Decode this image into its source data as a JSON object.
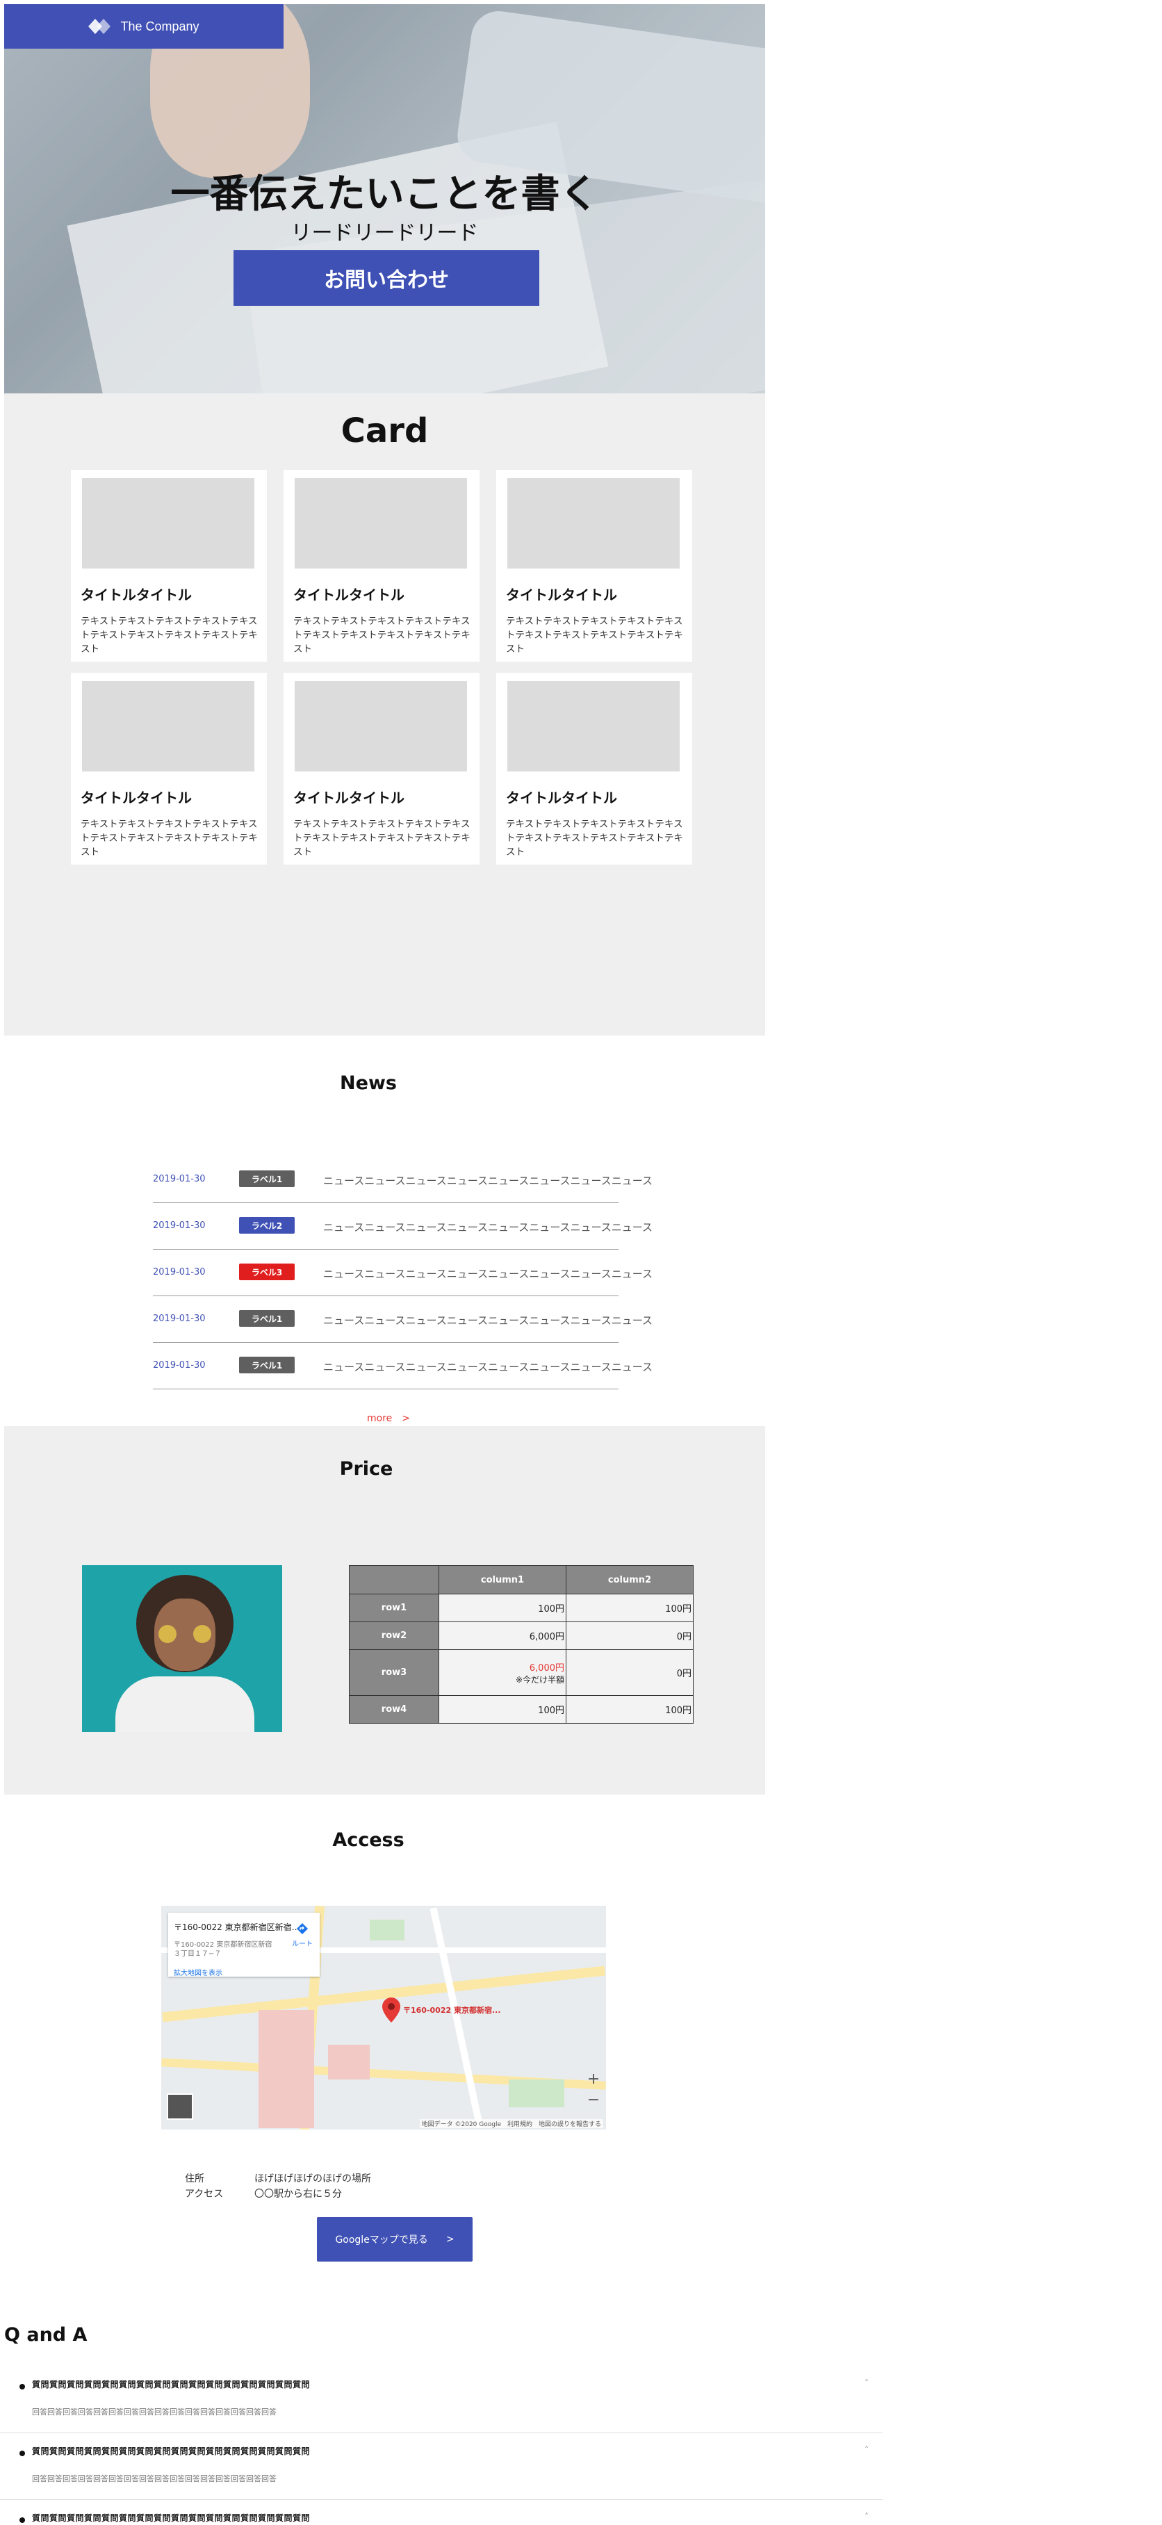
{
  "hero": {
    "logo_text": "The Company",
    "title": "一番伝えたいことを書く",
    "lead": "リードリードリード",
    "cta_label": "お問い合わせ"
  },
  "card_section": {
    "title": "Card",
    "cards": [
      {
        "title": "タイトルタイトル",
        "text": "テキストテキストテキストテキストテキストテキストテキストテキストテキストテキスト"
      },
      {
        "title": "タイトルタイトル",
        "text": "テキストテキストテキストテキストテキストテキストテキストテキストテキストテキスト"
      },
      {
        "title": "タイトルタイトル",
        "text": "テキストテキストテキストテキストテキストテキストテキストテキストテキストテキスト"
      },
      {
        "title": "タイトルタイトル",
        "text": "テキストテキストテキストテキストテキストテキストテキストテキストテキストテキスト"
      },
      {
        "title": "タイトルタイトル",
        "text": "テキストテキストテキストテキストテキストテキストテキストテキストテキストテキスト"
      },
      {
        "title": "タイトルタイトル",
        "text": "テキストテキストテキストテキストテキストテキストテキストテキストテキストテキスト"
      }
    ]
  },
  "news": {
    "title": "News",
    "items": [
      {
        "date": "2019-01-30",
        "label": "ラベル1",
        "label_color": "#5f5f5f",
        "text": "ニュースニュースニュースニュースニュースニュースニュースニュース"
      },
      {
        "date": "2019-01-30",
        "label": "ラベル2",
        "label_color": "#3f51b5",
        "text": "ニュースニュースニュースニュースニュースニュースニュースニュース"
      },
      {
        "date": "2019-01-30",
        "label": "ラベル3",
        "label_color": "#e01e1e",
        "text": "ニュースニュースニュースニュースニュースニュースニュースニュース"
      },
      {
        "date": "2019-01-30",
        "label": "ラベル1",
        "label_color": "#5f5f5f",
        "text": "ニュースニュースニュースニュースニュースニュースニュースニュース"
      },
      {
        "date": "2019-01-30",
        "label": "ラベル1",
        "label_color": "#5f5f5f",
        "text": "ニュースニュースニュースニュースニュースニュースニュースニュース"
      }
    ],
    "more_label": "more　>"
  },
  "price": {
    "title": "Price",
    "columns": [
      "column1",
      "column2"
    ],
    "rows": [
      {
        "head": "row1",
        "c1": "100円",
        "c2": "100円"
      },
      {
        "head": "row2",
        "c1": "6,000円",
        "c2": "0円"
      },
      {
        "head": "row3",
        "c1": "6,000円",
        "c1_note": "※今だけ半額",
        "c2": "0円"
      },
      {
        "head": "row4",
        "c1": "100円",
        "c2": "100円"
      }
    ]
  },
  "access": {
    "title": "Access",
    "map": {
      "card_title": "〒160-0022 東京都新宿区新宿…",
      "card_sub": "〒160-0022 東京都新宿区新宿３丁目１７−７",
      "card_link": "拡大地図を表示",
      "route_label": "ルート",
      "pin_label": "〒160-0022 東京都新宿...",
      "attribution": "地図データ ©2020 Google　利用規約　地図の誤りを報告する",
      "zoom_in": "+",
      "zoom_out": "−"
    },
    "info": [
      {
        "key": "住所",
        "value": "ほげほげほげのほげの場所"
      },
      {
        "key": "アクセス",
        "value": "〇〇駅から右に５分"
      }
    ],
    "button_label": "Googleマップで見る",
    "button_arrow": ">"
  },
  "qa": {
    "title": "Q and A",
    "items": [
      {
        "q": "質問質問質問質問質問質問質問質問質問質問質問質問質問質問質問質問",
        "a": "回答回答回答回答回答回答回答回答回答回答回答回答回答回答回答回答",
        "chev": "˄"
      },
      {
        "q": "質問質問質問質問質問質問質問質問質問質問質問質問質問質問質問質問",
        "a": "回答回答回答回答回答回答回答回答回答回答回答回答回答回答回答回答",
        "chev": "˄"
      },
      {
        "q": "質問質問質問質問質問質問質問質問質問質問質問質問質問質問質問質問",
        "a": "",
        "chev": "˄"
      }
    ]
  }
}
